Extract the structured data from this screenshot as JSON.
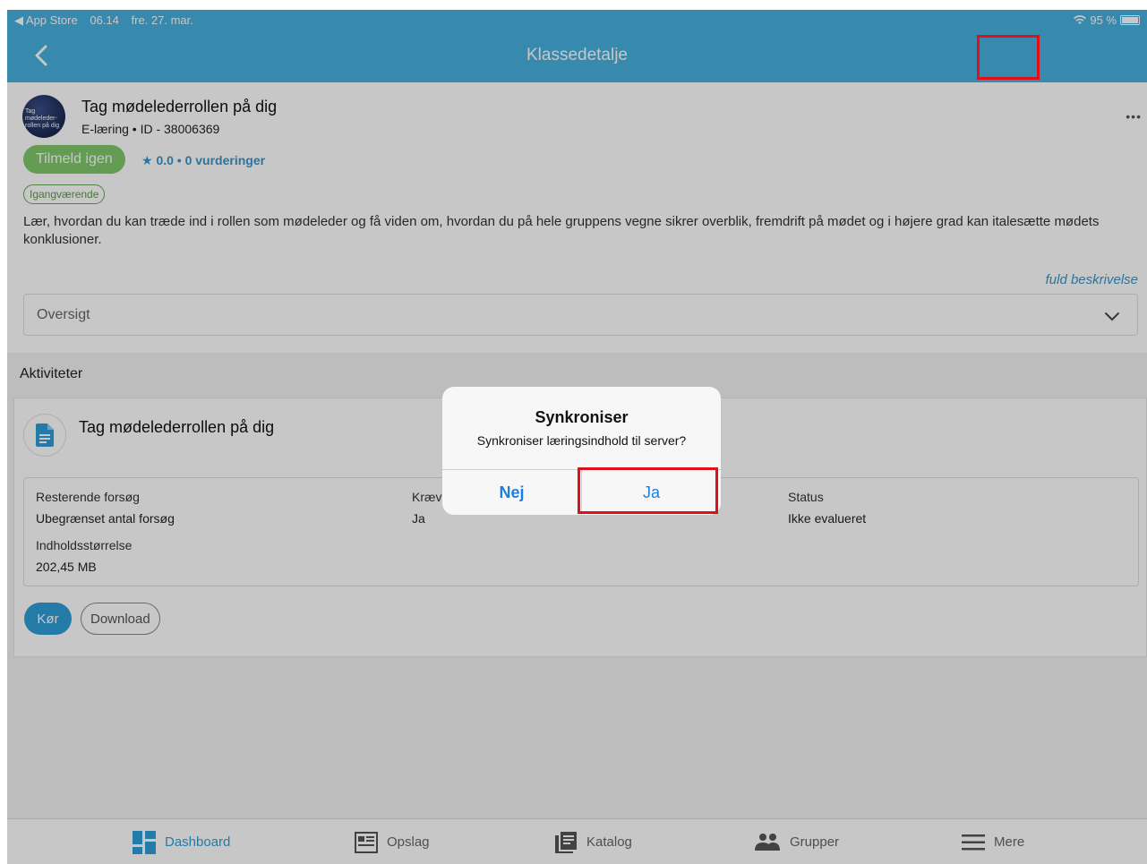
{
  "status_bar": {
    "back_app": "◀ App Store",
    "time": "06.14",
    "date": "fre. 27. mar.",
    "battery": "95 %"
  },
  "nav": {
    "title": "Klassedetalje"
  },
  "course": {
    "title": "Tag mødelederrollen på dig",
    "meta": "E-læring • ID - 38006369",
    "thumb_text": "Tag mødeleder-rollen på dig",
    "reenroll_label": "Tilmeld igen",
    "rating": "★ 0.0  •  0 vurderinger",
    "status_badge": "Igangværende",
    "description": "Lær, hvordan du kan træde ind i rollen som mødeleder og få viden om, hvordan du på hele gruppens vegne sikrer overblik, fremdrift på mødet og i højere grad kan italesætte mødets konklusioner.",
    "more": "•••",
    "full_description_link": "fuld beskrivelse",
    "overview_label": "Oversigt"
  },
  "activities": {
    "section_label": "Aktiviteter",
    "item": {
      "title": "Tag mødelederrollen på dig",
      "remaining_label": "Resterende forsøg",
      "remaining_value": "Ubegrænset antal forsøg",
      "required_label": "Kræv",
      "required_value": "Ja",
      "status_label": "Status",
      "status_value": "Ikke evalueret",
      "size_label": "Indholdsstørrelse",
      "size_value": "202,45 MB",
      "run_label": "Kør",
      "download_label": "Download"
    }
  },
  "tabs": [
    {
      "label": "Dashboard",
      "icon": "dashboard-icon",
      "active": true
    },
    {
      "label": "Opslag",
      "icon": "bulletin-icon",
      "active": false
    },
    {
      "label": "Katalog",
      "icon": "catalog-icon",
      "active": false
    },
    {
      "label": "Grupper",
      "icon": "groups-icon",
      "active": false
    },
    {
      "label": "Mere",
      "icon": "menu-icon",
      "active": false
    }
  ],
  "dialog": {
    "title": "Synkroniser",
    "message": "Synkroniser læringsindhold til server?",
    "no_label": "Nej",
    "yes_label": "Ja"
  },
  "colors": {
    "accent": "#47b0de",
    "primary_button": "#2f9ed8",
    "enroll_button": "#7fc86a",
    "highlight": "#e0101a",
    "link": "#1b7ee3"
  }
}
